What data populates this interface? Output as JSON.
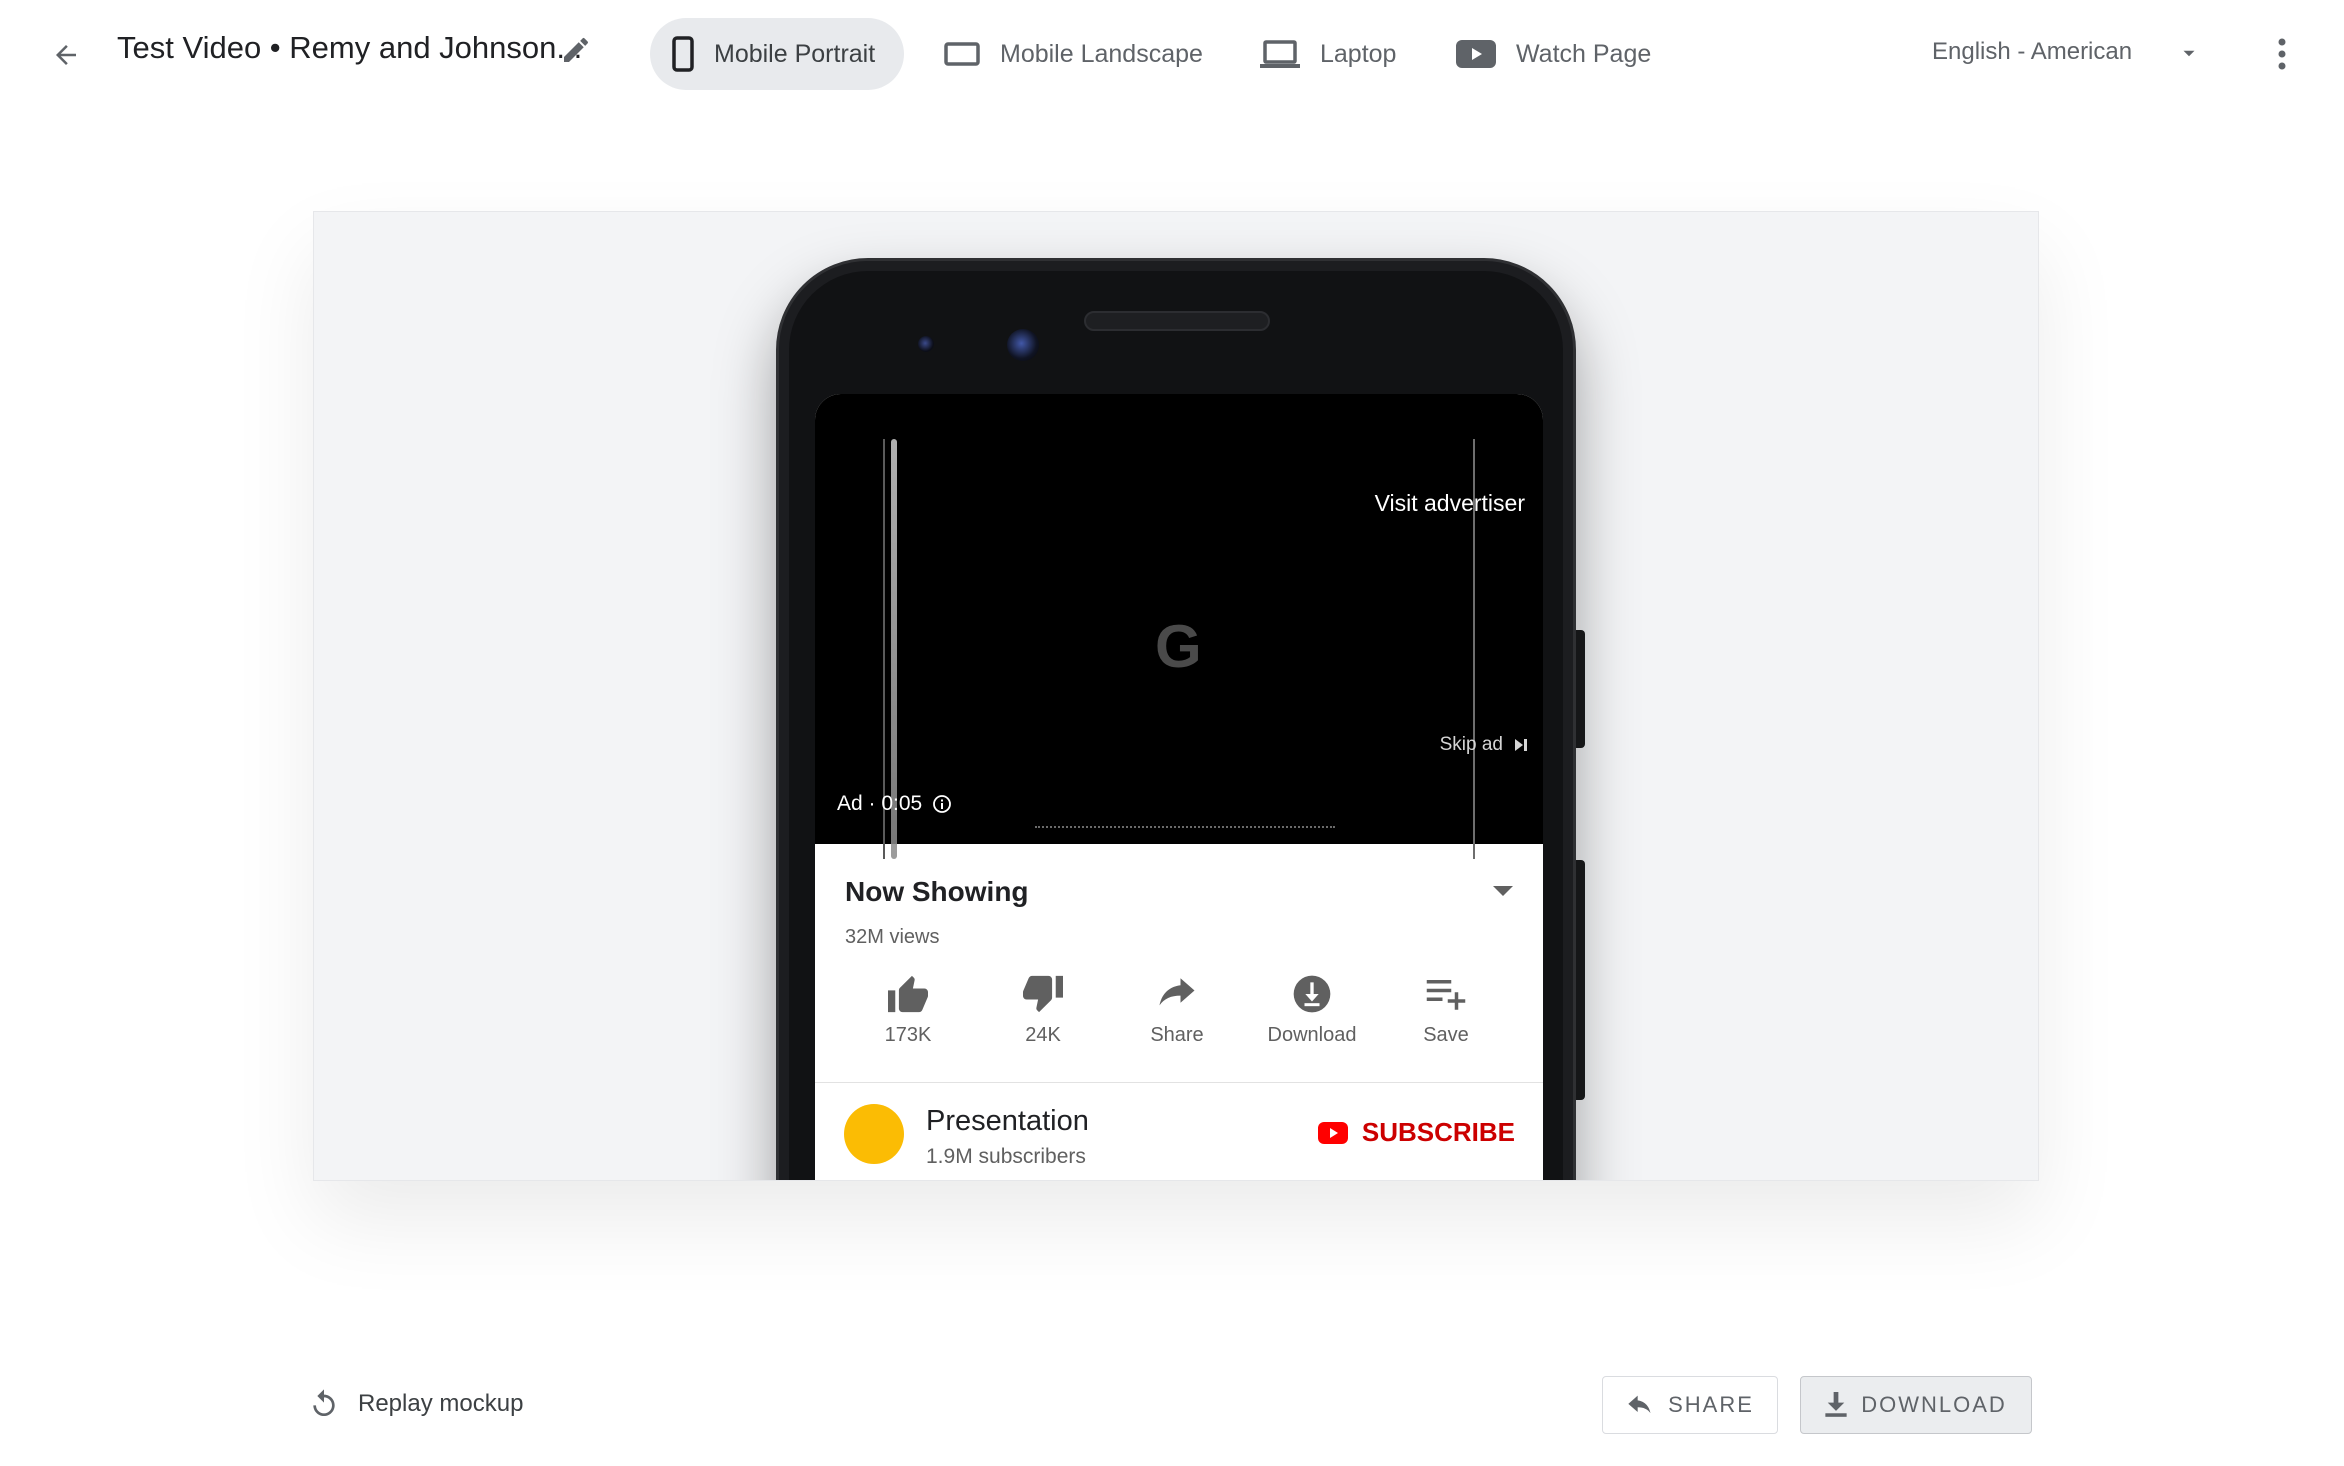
{
  "header": {
    "title": "Test Video • Remy and Johnson...",
    "back_icon": "arrow-back-icon",
    "edit_icon": "pencil-icon",
    "tabs": [
      {
        "label": "Mobile Portrait",
        "icon": "smartphone-icon",
        "active": true
      },
      {
        "label": "Mobile Landscape",
        "icon": "landscape-phone-icon",
        "active": false
      },
      {
        "label": "Laptop",
        "icon": "laptop-icon",
        "active": false
      },
      {
        "label": "Watch Page",
        "icon": "play-icon",
        "active": false
      }
    ],
    "language": "English - American",
    "more_icon": "more-vert-icon"
  },
  "mockup": {
    "video": {
      "visit_advertiser": "Visit advertiser",
      "skip_ad": "Skip ad",
      "ad_label": "Ad · 0:05",
      "logo": "G"
    },
    "info": {
      "title": "Now Showing",
      "views": "32M views",
      "actions": [
        {
          "label": "173K",
          "icon": "thumb-up-icon"
        },
        {
          "label": "24K",
          "icon": "thumb-down-icon"
        },
        {
          "label": "Share",
          "icon": "share-icon"
        },
        {
          "label": "Download",
          "icon": "download-icon"
        },
        {
          "label": "Save",
          "icon": "playlist-add-icon"
        }
      ]
    },
    "channel": {
      "name": "Presentation",
      "subscribers": "1.9M subscribers",
      "subscribe_label": "SUBSCRIBE",
      "avatar_color": "#fbbc04",
      "subscribe_color": "#cc0000"
    }
  },
  "footer": {
    "replay_label": "Replay mockup",
    "share_label": "SHARE",
    "download_label": "DOWNLOAD"
  },
  "colors": {
    "active_tab_bg": "#e8eaed",
    "stage_bg": "#f3f4f6"
  }
}
